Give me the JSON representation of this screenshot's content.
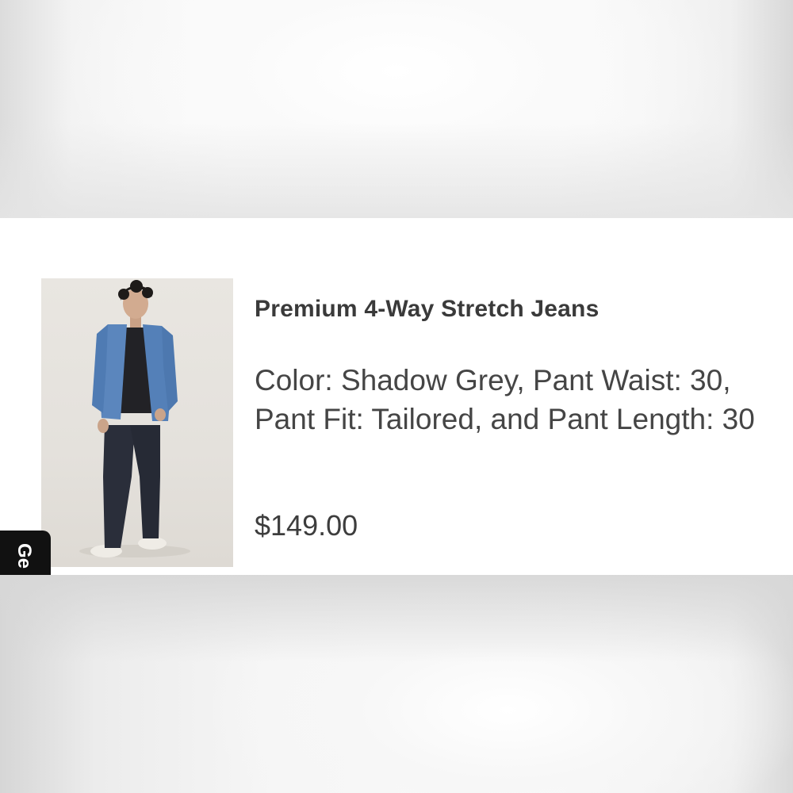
{
  "product": {
    "title": "Premium 4-Way Stretch Jeans",
    "variant": "Color: Shadow Grey, Pant Waist: 30, Pant Fit: Tailored, and Pant Length: 30",
    "price": "$149.00",
    "image_icon": "product-photo"
  },
  "side_tab": {
    "label": "Ge"
  },
  "colors": {
    "card_background": "#ffffff",
    "text_primary": "#3a3a3a",
    "side_tab_background": "#111111"
  }
}
